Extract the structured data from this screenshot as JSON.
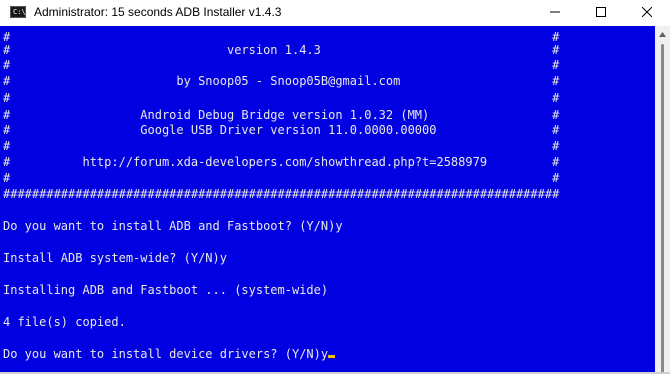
{
  "window": {
    "title": "Administrator:  15 seconds ADB Installer v1.4.3",
    "icon": "cmd-icon",
    "icon_label": "C:\\"
  },
  "controls": {
    "minimize_icon": "minimize-icon",
    "maximize_icon": "maximize-icon",
    "close_icon": "close-icon"
  },
  "console": {
    "background": "#0000e0",
    "text_color": "#e8e8e8",
    "cursor_color": "#f5c400",
    "lines": [
      "#                                                                           #",
      "#                              version 1.4.3                                #",
      "#                                                                           #",
      "#                       by Snoop05 - Snoop05B@gmail.com                     #",
      "#                                                                           #",
      "#                  Android Debug Bridge version 1.0.32 (MM)                 #",
      "#                  Google USB Driver version 11.0.0000.00000                #",
      "#                                                                           #",
      "#          http://forum.xda-developers.com/showthread.php?t=2588979         #",
      "#                                                                           #",
      "#############################################################################",
      "",
      "Do you want to install ADB and Fastboot? (Y/N)y",
      "",
      "Install ADB system-wide? (Y/N)y",
      "",
      "Installing ADB and Fastboot ... (system-wide)",
      "",
      "4 file(s) copied.",
      "",
      "Do you want to install device drivers? (Y/N)y"
    ]
  }
}
